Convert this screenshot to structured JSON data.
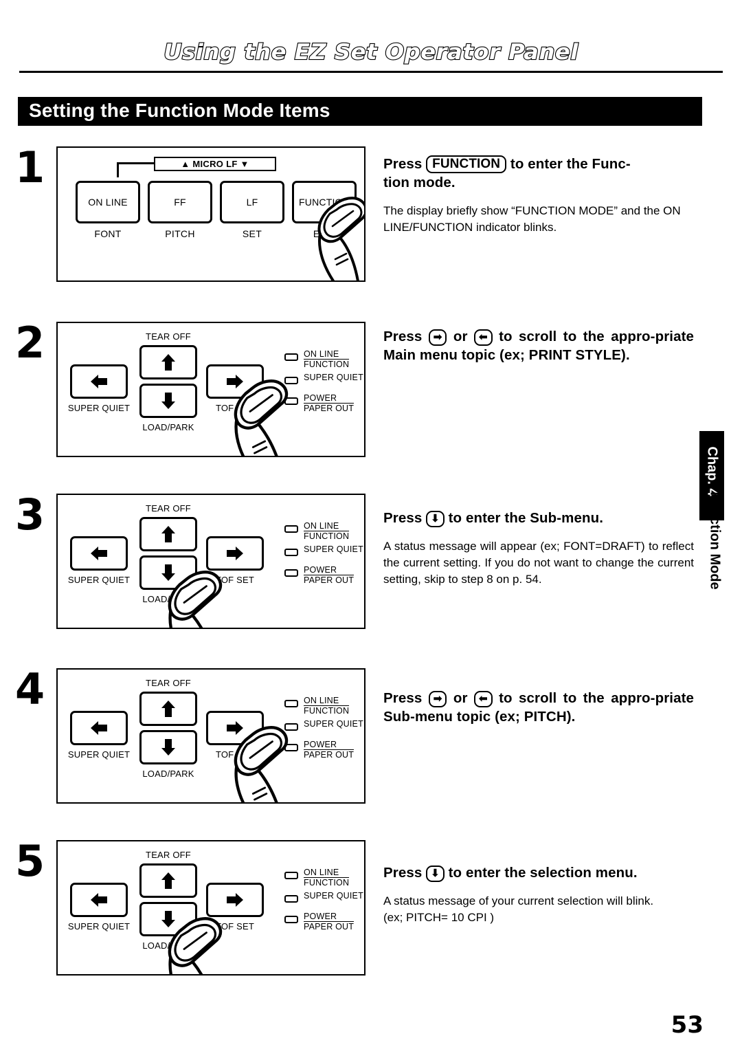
{
  "header": {
    "title": "Using the EZ Set Operator Panel"
  },
  "section": {
    "title": "Setting the Function Mode Items"
  },
  "page_number": "53",
  "side_tab": {
    "chapter": "Chap. 4",
    "subject": "Function Mode"
  },
  "panel_step1": {
    "display_label": "▲ MICRO LF ▼",
    "keys": [
      {
        "label": "ON LINE",
        "sublabel": "FONT"
      },
      {
        "label": "FF",
        "sublabel": "PITCH"
      },
      {
        "label": "LF",
        "sublabel": "SET"
      },
      {
        "label": "FUNCTION",
        "sublabel": "EXIT"
      }
    ]
  },
  "panel_pad": {
    "tear_off_label": "TEAR OFF",
    "load_park_label": "LOAD/PARK",
    "super_quiet_label": "SUPER QUIET",
    "tof_set_label": "TOF SET",
    "arrows": {
      "up": "⬆",
      "down": "⬇",
      "left": "⬅",
      "right": "➡"
    },
    "leds": [
      {
        "line1": "ON LINE",
        "line2": "FUNCTION",
        "split": true
      },
      {
        "line1": "SUPER QUIET",
        "line2": "",
        "split": false
      },
      {
        "line1": "POWER",
        "line2": "PAPER OUT",
        "split": true
      }
    ]
  },
  "steps": [
    {
      "number": "1",
      "pressed_key": "FUNCTION",
      "main_pre": "Press ",
      "main_keycap": "FUNCTION",
      "main_post": " to enter the Func-",
      "main_line2": "tion mode.",
      "sub": "The display briefly show “FUNCTION MODE” and the ON LINE/FUNCTION indicator blinks."
    },
    {
      "number": "2",
      "pressed_key": "right",
      "main_pre": "Press ",
      "main_keycap_a": "➡",
      "main_mid": " or ",
      "main_keycap_b": "⬅",
      "main_post": " to scroll to the appro-priate Main menu topic (ex; PRINT STYLE).",
      "sub": ""
    },
    {
      "number": "3",
      "pressed_key": "down",
      "main_pre": "Press ",
      "main_keycap": "⬇",
      "main_post": " to enter the Sub-menu.",
      "sub": "A status message will appear (ex; FONT=DRAFT) to reflect the current setting. If you do not want to change the current setting, skip to step 8 on p. 54."
    },
    {
      "number": "4",
      "pressed_key": "right",
      "main_pre": "Press ",
      "main_keycap_a": "➡",
      "main_mid": " or ",
      "main_keycap_b": "⬅",
      "main_post": " to scroll to the appro-priate Sub-menu topic (ex;  PITCH).",
      "sub": ""
    },
    {
      "number": "5",
      "pressed_key": "down",
      "main_pre": "Press ",
      "main_keycap": "⬇",
      "main_post": " to enter the selection menu.",
      "sub": "A status message of your current selection will blink.",
      "sub_line2": "(ex;  PITCH=  10 CPI )"
    }
  ]
}
